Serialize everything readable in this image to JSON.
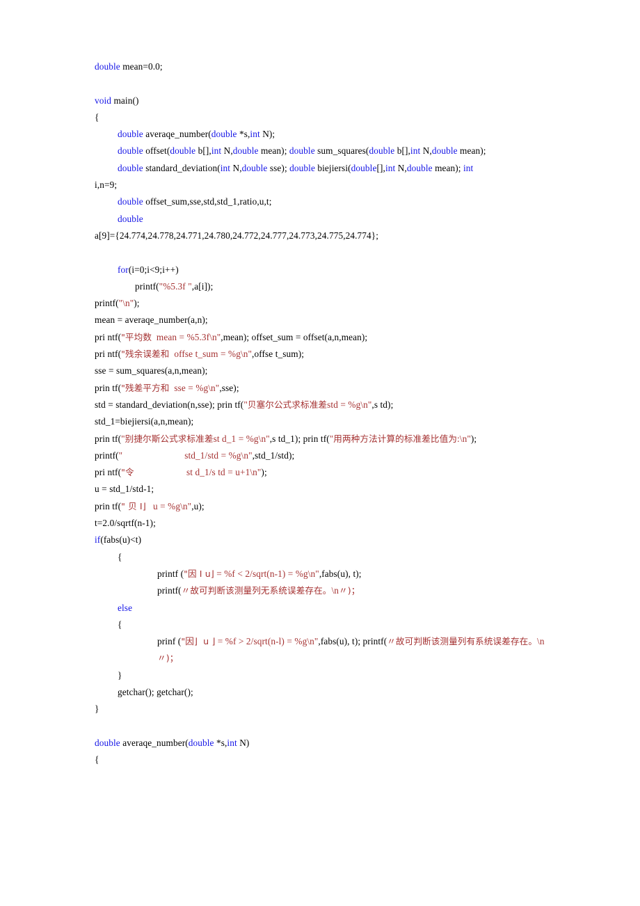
{
  "document": {
    "type": "source-code-listing",
    "language": "C",
    "colors": {
      "keyword": "#1414e6",
      "string": "#a53232",
      "plain": "#000000",
      "background": "#ffffff"
    }
  },
  "lines": [
    {
      "id": "l01",
      "indent": 0,
      "spans": [
        {
          "t": "double",
          "c": "kw"
        },
        {
          "t": " mean=0.0;",
          "c": "pl"
        }
      ]
    },
    {
      "id": "l02",
      "blank": true,
      "spans": []
    },
    {
      "id": "l03",
      "indent": 0,
      "spans": [
        {
          "t": "void",
          "c": "kw"
        },
        {
          "t": " main()",
          "c": "pl"
        }
      ]
    },
    {
      "id": "l04",
      "indent": 0,
      "spans": [
        {
          "t": "{",
          "c": "pl"
        }
      ]
    },
    {
      "id": "l05",
      "indent": 1,
      "spans": [
        {
          "t": "double",
          "c": "kw"
        },
        {
          "t": " averaqe_number(",
          "c": "pl"
        },
        {
          "t": "double",
          "c": "kw"
        },
        {
          "t": " *s,",
          "c": "pl"
        },
        {
          "t": "int",
          "c": "kw"
        },
        {
          "t": " N);",
          "c": "pl"
        }
      ]
    },
    {
      "id": "l06",
      "indent": 1,
      "spans": [
        {
          "t": "double",
          "c": "kw"
        },
        {
          "t": " offset(",
          "c": "pl"
        },
        {
          "t": "double",
          "c": "kw"
        },
        {
          "t": " b[],",
          "c": "pl"
        },
        {
          "t": "int",
          "c": "kw"
        },
        {
          "t": " N,",
          "c": "pl"
        },
        {
          "t": "double",
          "c": "kw"
        },
        {
          "t": " mean); ",
          "c": "pl"
        },
        {
          "t": "double",
          "c": "kw"
        },
        {
          "t": " sum_squares(",
          "c": "pl"
        },
        {
          "t": "double",
          "c": "kw"
        },
        {
          "t": " b[],",
          "c": "pl"
        },
        {
          "t": "int",
          "c": "kw"
        },
        {
          "t": " N,",
          "c": "pl"
        },
        {
          "t": "double",
          "c": "kw"
        },
        {
          "t": " mean);",
          "c": "pl"
        }
      ]
    },
    {
      "id": "l07",
      "indent": 1,
      "spans": [
        {
          "t": "double",
          "c": "kw"
        },
        {
          "t": " standard_deviation(",
          "c": "pl"
        },
        {
          "t": "int",
          "c": "kw"
        },
        {
          "t": " N,",
          "c": "pl"
        },
        {
          "t": "double",
          "c": "kw"
        },
        {
          "t": " sse); ",
          "c": "pl"
        },
        {
          "t": "double",
          "c": "kw"
        },
        {
          "t": " biejiersi(",
          "c": "pl"
        },
        {
          "t": "double",
          "c": "kw"
        },
        {
          "t": "[],",
          "c": "pl"
        },
        {
          "t": "int",
          "c": "kw"
        },
        {
          "t": " N,",
          "c": "pl"
        },
        {
          "t": "double",
          "c": "kw"
        },
        {
          "t": " mean); ",
          "c": "pl"
        },
        {
          "t": "int",
          "c": "kw"
        }
      ]
    },
    {
      "id": "l08",
      "indent": 0,
      "spans": [
        {
          "t": "i,n=9;",
          "c": "pl"
        }
      ]
    },
    {
      "id": "l09",
      "indent": 1,
      "spans": [
        {
          "t": "double",
          "c": "kw"
        },
        {
          "t": " offset_sum,sse,std,std_1,ratio,u,t;",
          "c": "pl"
        }
      ]
    },
    {
      "id": "l10",
      "indent": 1,
      "spans": [
        {
          "t": "double",
          "c": "kw"
        }
      ]
    },
    {
      "id": "l11",
      "indent": 0,
      "spans": [
        {
          "t": "a[9]={24.774,24.778,24.771,24.780,24.772,24.777,24.773,24.775,24.774};",
          "c": "pl"
        }
      ]
    },
    {
      "id": "l12",
      "blank": true,
      "spans": []
    },
    {
      "id": "l13",
      "indent": 1,
      "spans": [
        {
          "t": "for",
          "c": "kw"
        },
        {
          "t": "(i=0;i<9;i++)",
          "c": "pl"
        }
      ]
    },
    {
      "id": "l14",
      "indent": 2,
      "spans": [
        {
          "t": "printf(",
          "c": "pl"
        },
        {
          "t": "\"%5.3f \"",
          "c": "str"
        },
        {
          "t": ",a[i]);",
          "c": "pl"
        }
      ]
    },
    {
      "id": "l15",
      "indent": 0,
      "spans": [
        {
          "t": "printf(",
          "c": "pl"
        },
        {
          "t": "\"\\n\"",
          "c": "str"
        },
        {
          "t": ");",
          "c": "pl"
        }
      ]
    },
    {
      "id": "l16",
      "indent": 0,
      "spans": [
        {
          "t": "mean = averaqe_number(a,n);",
          "c": "pl"
        }
      ]
    },
    {
      "id": "l17",
      "indent": 0,
      "spans": [
        {
          "t": "pri ntf(",
          "c": "pl"
        },
        {
          "t": "\"平均数",
          "c": "str",
          "cjk": true
        },
        {
          "t": "  mean = %5.3f\\n\"",
          "c": "str"
        },
        {
          "t": ",mean); offset_sum = offset(a,n,mean);",
          "c": "pl"
        }
      ]
    },
    {
      "id": "l18",
      "indent": 0,
      "spans": [
        {
          "t": "pri ntf(",
          "c": "pl"
        },
        {
          "t": "\"残余误差和",
          "c": "str",
          "cjk": true
        },
        {
          "t": "  offse t_sum = %g\\n\"",
          "c": "str"
        },
        {
          "t": ",offse t_sum);",
          "c": "pl"
        }
      ]
    },
    {
      "id": "l19",
      "indent": 0,
      "spans": [
        {
          "t": "sse = sum_squares(a,n,mean);",
          "c": "pl"
        }
      ]
    },
    {
      "id": "l20",
      "indent": 0,
      "spans": [
        {
          "t": "prin tf(",
          "c": "pl"
        },
        {
          "t": "\"残差平方和",
          "c": "str",
          "cjk": true
        },
        {
          "t": "  sse = %g\\n\"",
          "c": "str"
        },
        {
          "t": ",sse);",
          "c": "pl"
        }
      ]
    },
    {
      "id": "l21",
      "indent": 0,
      "spans": [
        {
          "t": "std = standard_deviation(n,sse); prin tf(",
          "c": "pl"
        },
        {
          "t": "\"",
          "c": "str"
        },
        {
          "t": "贝塞尔公式求标准差",
          "c": "str",
          "cjk": true
        },
        {
          "t": "std = %g\\n\"",
          "c": "str"
        },
        {
          "t": ",s td);",
          "c": "pl"
        }
      ]
    },
    {
      "id": "l22",
      "indent": 0,
      "spans": [
        {
          "t": "std_1=biejiersi(a,n,mean);",
          "c": "pl"
        }
      ]
    },
    {
      "id": "l23",
      "indent": 0,
      "spans": [
        {
          "t": "prin tf(",
          "c": "pl"
        },
        {
          "t": "\"",
          "c": "str"
        },
        {
          "t": "别捷尔斯公式求标准差",
          "c": "str",
          "cjk": true
        },
        {
          "t": "st d_1 = %g\\n\"",
          "c": "str"
        },
        {
          "t": ",s td_1); prin tf(",
          "c": "pl"
        },
        {
          "t": "\"",
          "c": "str"
        },
        {
          "t": "用两种方法计算的标准差比值为",
          "c": "str",
          "cjk": true
        },
        {
          "t": ":\\n\"",
          "c": "str"
        },
        {
          "t": ");",
          "c": "pl"
        }
      ]
    },
    {
      "id": "l24",
      "indent": 0,
      "spans": [
        {
          "t": "printf(",
          "c": "pl"
        },
        {
          "t": "\"                          std_1/std = %g\\n\"",
          "c": "str"
        },
        {
          "t": ",std_1/std);",
          "c": "pl"
        }
      ]
    },
    {
      "id": "l25",
      "indent": 0,
      "spans": [
        {
          "t": "pri ntf(",
          "c": "pl"
        },
        {
          "t": "\"令",
          "c": "str",
          "cjk": true
        },
        {
          "t": "                      st d_1/s td = u+1\\n\"",
          "c": "str"
        },
        {
          "t": ");",
          "c": "pl"
        }
      ]
    },
    {
      "id": "l26",
      "indent": 0,
      "spans": [
        {
          "t": "u = std_1/std-1;",
          "c": "pl"
        }
      ]
    },
    {
      "id": "l27",
      "indent": 0,
      "spans": [
        {
          "t": "prin tf(",
          "c": "pl"
        },
        {
          "t": "\" 贝 I⌋",
          "c": "str",
          "cjk": true
        },
        {
          "t": "   u = %g\\n\"",
          "c": "str"
        },
        {
          "t": ",u);",
          "c": "pl"
        }
      ]
    },
    {
      "id": "l28",
      "indent": 0,
      "spans": [
        {
          "t": "t=2.0/sqrtf(n-1);",
          "c": "pl"
        }
      ]
    },
    {
      "id": "l29",
      "indent": 0,
      "spans": [
        {
          "t": "if",
          "c": "kw"
        },
        {
          "t": "(fabs(u)<t)",
          "c": "pl"
        }
      ]
    },
    {
      "id": "l30",
      "indent": 1,
      "spans": [
        {
          "t": "{",
          "c": "pl"
        }
      ]
    },
    {
      "id": "l31",
      "indent": 3,
      "spans": [
        {
          "t": "printf (",
          "c": "pl"
        },
        {
          "t": "\"因",
          "c": "str",
          "cjk": true
        },
        {
          "t": " Ⅰ u⌋",
          "c": "str",
          "cjk": true
        },
        {
          "t": " = %f < 2/sqrt(n-1) = %g\\n\"",
          "c": "str"
        },
        {
          "t": ",fabs(u), t);",
          "c": "pl"
        }
      ]
    },
    {
      "id": "l32",
      "indent": 3,
      "spans": [
        {
          "t": "printf(",
          "c": "pl"
        },
        {
          "t": "〃故可判断该测量列无系统误差存在。",
          "c": "str",
          "cjk": true
        },
        {
          "t": "\\n",
          "c": "str"
        },
        {
          "t": "〃)；",
          "c": "str",
          "cjk": true
        }
      ]
    },
    {
      "id": "l33",
      "indent": 1,
      "spans": [
        {
          "t": "else",
          "c": "kw"
        }
      ]
    },
    {
      "id": "l34",
      "indent": 1,
      "spans": [
        {
          "t": "{",
          "c": "pl"
        }
      ]
    },
    {
      "id": "l35",
      "indent": 3,
      "spans": [
        {
          "t": "prinf (",
          "c": "pl"
        },
        {
          "t": "\"因⌋",
          "c": "str",
          "cjk": true
        },
        {
          "t": "  u ⌋",
          "c": "str",
          "cjk": true
        },
        {
          "t": " = %f > 2/sqrt(n-l) = %g\\n\"",
          "c": "str"
        },
        {
          "t": ",fabs(u), t); printf(",
          "c": "pl"
        },
        {
          "t": "〃故可判断该测量列有系统误差存在。",
          "c": "str",
          "cjk": true
        },
        {
          "t": "\\n",
          "c": "str"
        },
        {
          "t": "〃)；",
          "c": "str",
          "cjk": true
        }
      ]
    },
    {
      "id": "l36",
      "indent": 1,
      "spans": [
        {
          "t": "}",
          "c": "pl"
        }
      ]
    },
    {
      "id": "l37",
      "indent": 1,
      "spans": [
        {
          "t": "getchar(); getchar();",
          "c": "pl"
        }
      ]
    },
    {
      "id": "l38",
      "indent": 0,
      "spans": [
        {
          "t": "}",
          "c": "pl"
        }
      ]
    },
    {
      "id": "l39",
      "blank": true,
      "spans": []
    },
    {
      "id": "l40",
      "indent": 0,
      "spans": [
        {
          "t": "double",
          "c": "kw"
        },
        {
          "t": " averaqe_number(",
          "c": "pl"
        },
        {
          "t": "double",
          "c": "kw"
        },
        {
          "t": " *s,",
          "c": "pl"
        },
        {
          "t": "int",
          "c": "kw"
        },
        {
          "t": " N)",
          "c": "pl"
        }
      ]
    },
    {
      "id": "l41",
      "indent": 0,
      "spans": [
        {
          "t": "{",
          "c": "pl"
        }
      ]
    }
  ]
}
